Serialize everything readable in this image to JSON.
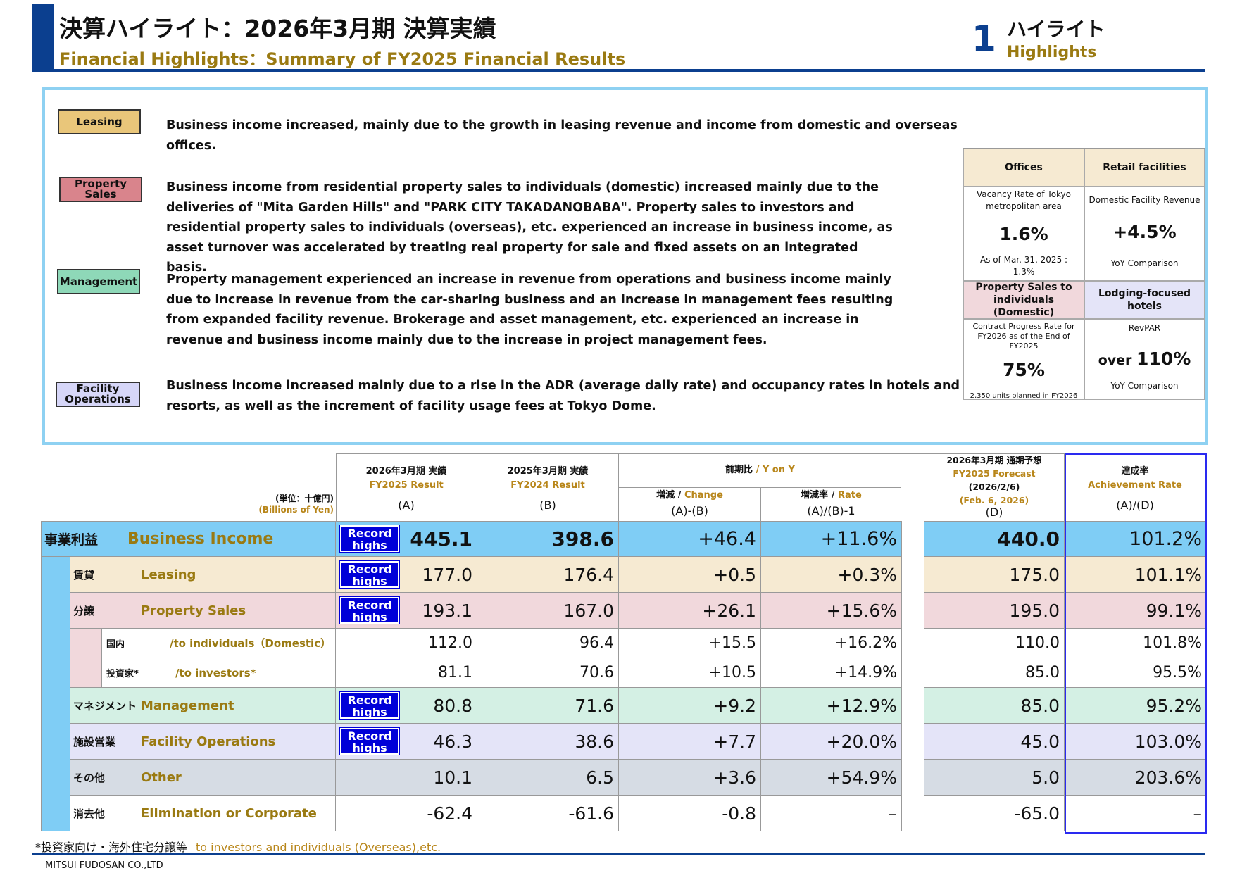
{
  "header": {
    "title_jp": "決算ハイライト：2026年3月期 決算実績",
    "title_en": "Financial Highlights：Summary of FY2025 Financial Results",
    "section_number": "1",
    "section_jp": "ハイライト",
    "section_en": "Highlights"
  },
  "segments": [
    {
      "tag": "Leasing",
      "color": "#e9c67a",
      "text": "Business income increased, mainly due to the growth in leasing revenue and income from domestic and overseas offices."
    },
    {
      "tag": "Property Sales",
      "color": "#d9848c",
      "text": "Business income from residential property sales to individuals (domestic) increased mainly due to the deliveries of \"Mita Garden Hills\" and \"PARK CITY TAKADANOBABA\". Property sales to investors and residential property sales to individuals (overseas), etc. experienced an increase in business income, as asset turnover was accelerated by treating real property for sale and fixed assets on an integrated basis."
    },
    {
      "tag": "Management",
      "color": "#8ed8b8",
      "text": "Property management experienced an increase in revenue from operations and business income mainly due to increase in revenue from the car-sharing business and an increase in management fees resulting from expanded facility revenue. Brokerage and asset management, etc. experienced an increase in revenue and business income mainly due to the increase in project management fees."
    },
    {
      "tag": "Facility Operations",
      "color": "#d6d6f8",
      "text": "Business income increased mainly due to a rise in the ADR (average daily rate) and occupancy rates in hotels and resorts, as well as the increment of facility usage fees at Tokyo Dome."
    }
  ],
  "kpis": [
    {
      "head": "Offices",
      "sub": "Vacancy Rate of Tokyo metropolitan area",
      "value": "1.6%",
      "prefix": "",
      "note": "As of Mar. 31, 2025 : 1.3%",
      "bg": "#f6ead2"
    },
    {
      "head": "Retail facilities",
      "sub": "Domestic Facility Revenue",
      "value": "+4.5%",
      "prefix": "",
      "note": "YoY Comparison",
      "bg": "#f6ead2"
    },
    {
      "head": "Property Sales to individuals (Domestic)",
      "sub": "Contract Progress Rate for FY2026 as of the End of FY2025",
      "value": "75%",
      "prefix": "",
      "note": "2,350 units planned in FY2026",
      "bg": "#f1d8dc"
    },
    {
      "head": "Lodging-focused hotels",
      "sub": "RevPAR",
      "value": "110%",
      "prefix": "over ",
      "note": "YoY Comparison",
      "bg": "#e4e4f8"
    }
  ],
  "table": {
    "unit_jp": "(単位：十億円)",
    "unit_en": "(Billions of Yen)",
    "col_a_jp": "2026年3月期  実績",
    "col_a_en": "FY2025 Result",
    "col_a_code": "(A)",
    "col_b_jp": "2025年3月期  実績",
    "col_b_en": "FY2024 Result",
    "col_b_code": "(B)",
    "yoy_jp": "前期比",
    "yoy_en": " / Y on Y",
    "chg_jp": "増減",
    "chg_en": "Change",
    "chg_code": "(A)-(B)",
    "rate_jp": "増減率",
    "rate_en": "Rate",
    "rate_code": "(A)/(B)-1",
    "fc_jp": "2026年3月期 通期予想",
    "fc_en": "FY2025 Forecast",
    "fc_date_jp": "(2026/2/6)",
    "fc_date_en": "(Feb. 6, 2026)",
    "fc_code": "(D)",
    "ach_jp": "達成率",
    "ach_en": "Achievement Rate",
    "ach_code": "(A)/(D)",
    "record_label": "Record highs",
    "sep": " / ",
    "rows": [
      {
        "jp": "事業利益",
        "en": "Business Income",
        "a": "445.1",
        "b": "398.6",
        "chg": "+46.4",
        "rate": "+11.6%",
        "d": "440.0",
        "ach": "101.2%",
        "record": true
      },
      {
        "jp": "賃貸",
        "en": "Leasing",
        "a": "177.0",
        "b": "176.4",
        "chg": "+0.5",
        "rate": "+0.3%",
        "d": "175.0",
        "ach": "101.1%",
        "record": true
      },
      {
        "jp": "分譲",
        "en": "Property Sales",
        "a": "193.1",
        "b": "167.0",
        "chg": "+26.1",
        "rate": "+15.6%",
        "d": "195.0",
        "ach": "99.1%",
        "record": true
      },
      {
        "jp": "国内",
        "en": "/to individuals（Domestic）",
        "a": "112.0",
        "b": "96.4",
        "chg": "+15.5",
        "rate": "+16.2%",
        "d": "110.0",
        "ach": "101.8%",
        "record": false
      },
      {
        "jp": "投資家*",
        "en": "/to investors*",
        "a": "81.1",
        "b": "70.6",
        "chg": "+10.5",
        "rate": "+14.9%",
        "d": "85.0",
        "ach": "95.5%",
        "record": false
      },
      {
        "jp": "マネジメント",
        "en": "Management",
        "a": "80.8",
        "b": "71.6",
        "chg": "+9.2",
        "rate": "+12.9%",
        "d": "85.0",
        "ach": "95.2%",
        "record": true
      },
      {
        "jp": "施設営業",
        "en": "Facility Operations",
        "a": "46.3",
        "b": "38.6",
        "chg": "+7.7",
        "rate": "+20.0%",
        "d": "45.0",
        "ach": "103.0%",
        "record": true
      },
      {
        "jp": "その他",
        "en": "Other",
        "a": "10.1",
        "b": "6.5",
        "chg": "+3.6",
        "rate": "+54.9%",
        "d": "5.0",
        "ach": "203.6%",
        "record": false
      },
      {
        "jp": "消去他",
        "en": "Elimination or Corporate",
        "a": "-62.4",
        "b": "-61.6",
        "chg": "-0.8",
        "rate": "–",
        "d": "-65.0",
        "ach": "–",
        "record": false
      }
    ]
  },
  "footnote_jp": "*投資家向け・海外住宅分譲等",
  "footnote_en": "to investors and individuals (Overseas),etc.",
  "company": "MITSUI FUDOSAN CO.,LTD"
}
